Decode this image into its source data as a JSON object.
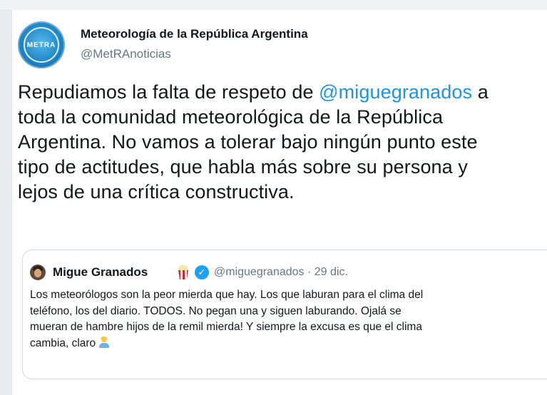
{
  "tweet": {
    "account_name": "Meteorología de la República Argentina",
    "account_handle": "@MetRAnoticias",
    "avatar_text": "METRA",
    "text": {
      "line1_before": "Repudiamos la falta de respeto de ",
      "mention": "@miguegranados",
      "line1_after": " a",
      "line2": "toda la comunidad meteorológica de la República",
      "line3": "Argentina. No vamos a tolerar bajo ningún punto este",
      "line4": "tipo de actitudes, que habla más sobre su persona y",
      "line5": "lejos de una crítica constructiva."
    }
  },
  "quoted_tweet": {
    "name": "Migue Granados",
    "name_emoji": "popcorn-icon",
    "verified_icon": "verified-badge-icon",
    "verified_glyph": "✓",
    "handle_date": "@miguegranados · 29 dic.",
    "lines": [
      "Los meteorólogos son la peor mierda que hay. Los que laburan para el clima del",
      "teléfono, los del diario. TODOS. No pegan una y siguen laburando. Ojalá se",
      "mueran de hambre hijos de la remil mierda! Y siempre la excusa es que el clima",
      "cambia, claro"
    ],
    "end_emoji": "person-shrugging-icon"
  },
  "colors": {
    "mention": "#1b95e0",
    "verified": "#1da1f2",
    "text": "#14171a",
    "secondary": "#657786"
  }
}
